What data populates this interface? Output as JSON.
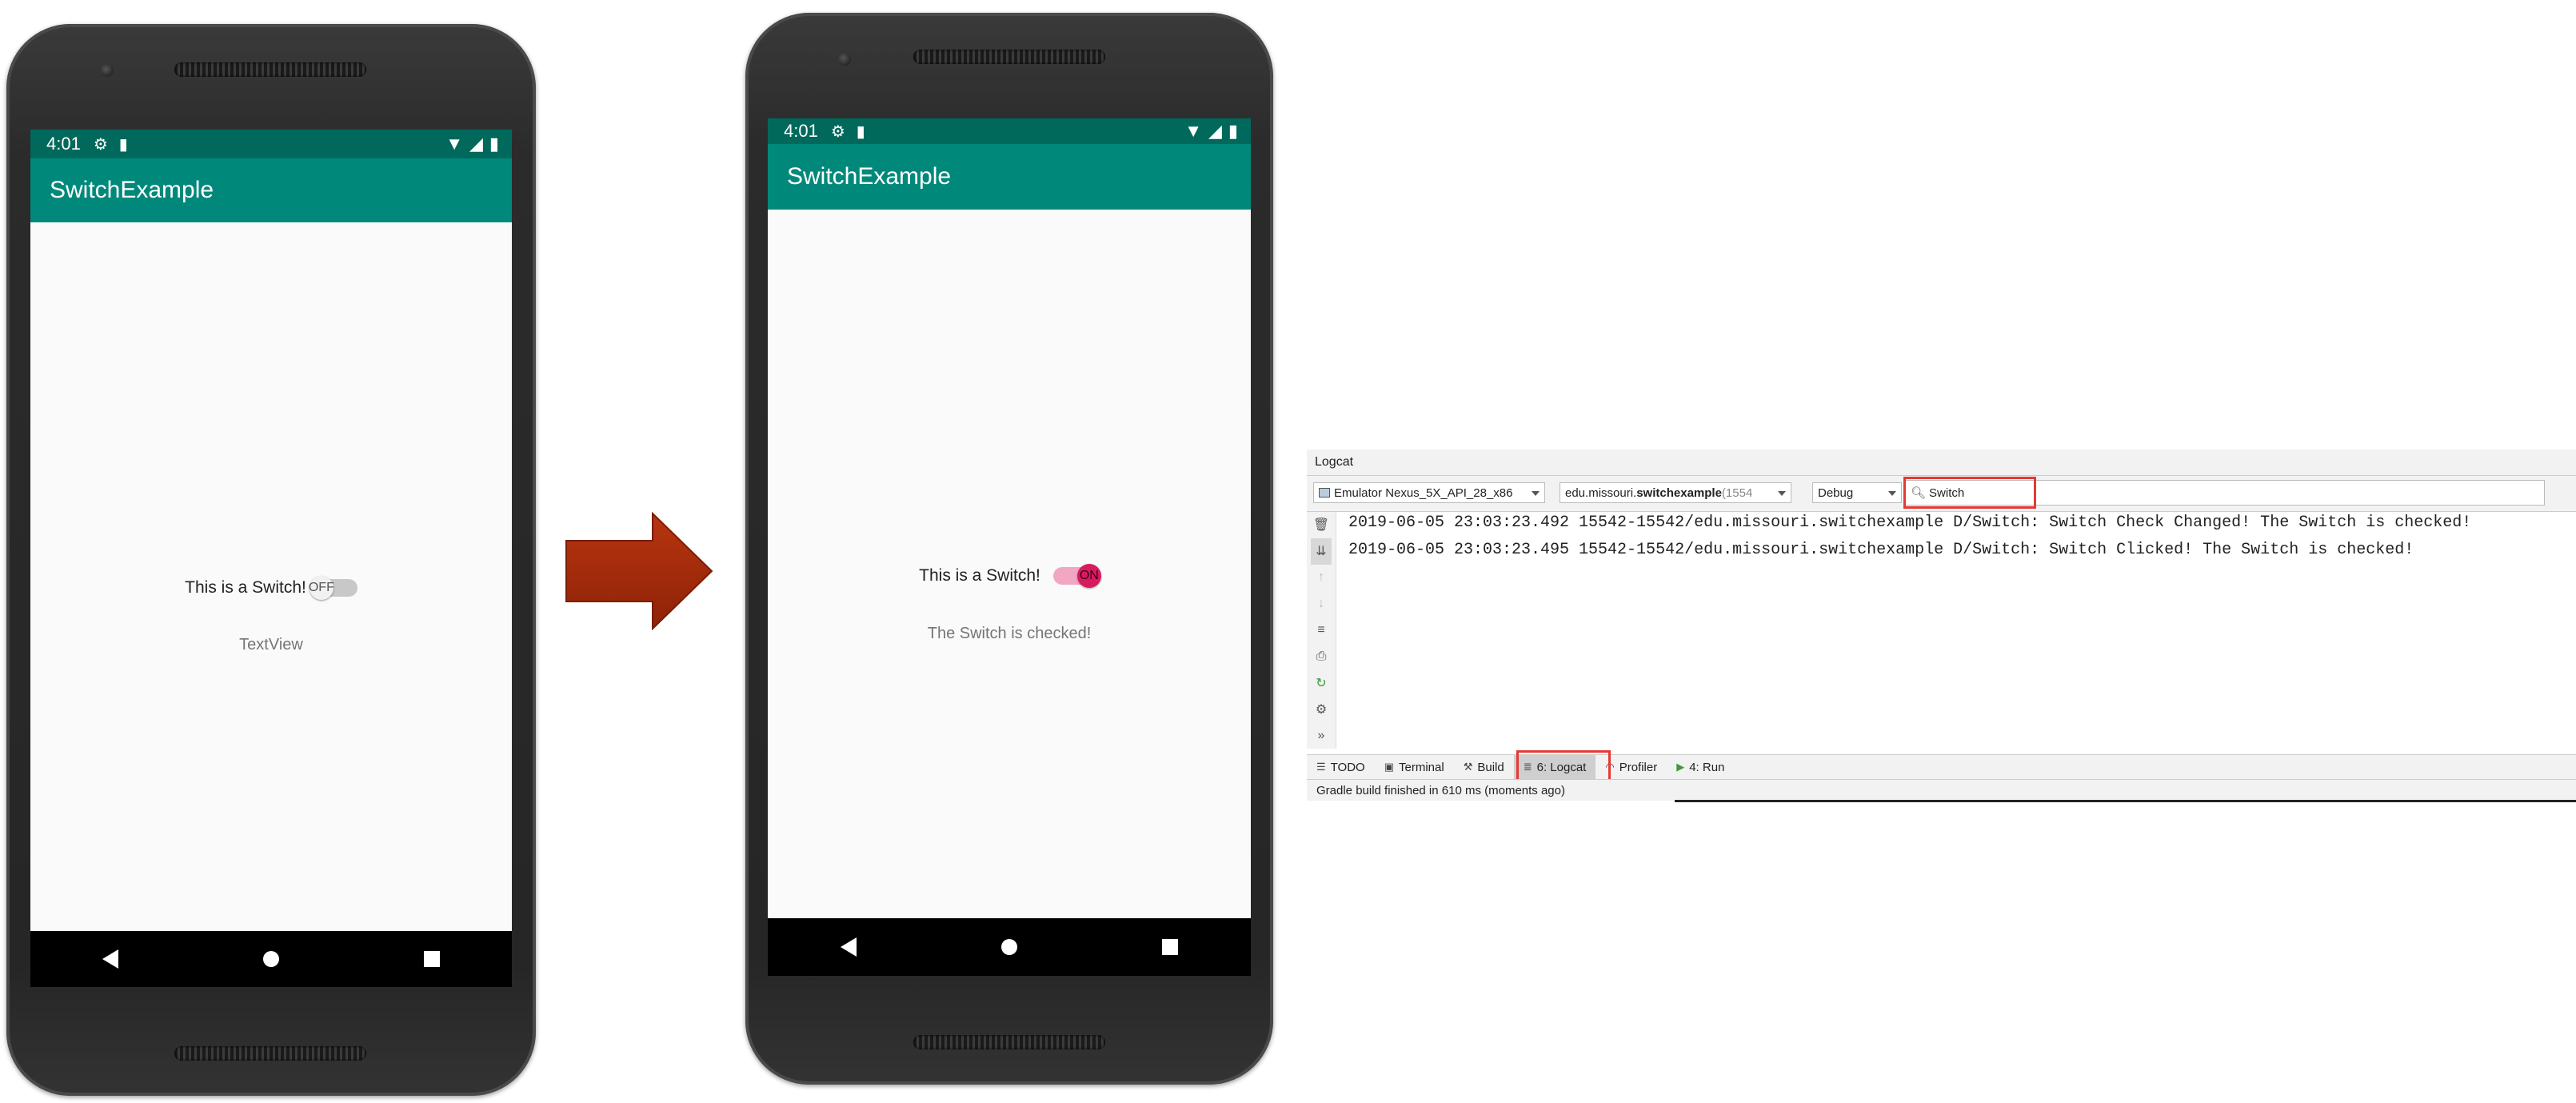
{
  "phone_before": {
    "status_time": "4:01",
    "app_title": "SwitchExample",
    "switch_label": "This is a Switch!",
    "switch_state_text": "OFF",
    "status_text": "TextView"
  },
  "phone_after": {
    "status_time": "4:01",
    "app_title": "SwitchExample",
    "switch_label": "This is a Switch!",
    "switch_state_text": "ON",
    "status_text": "The Switch is checked!"
  },
  "colors": {
    "status_bar": "#00695c",
    "app_bar": "#00897b",
    "switch_on": "#d81b60",
    "arrow": "#a52a0d",
    "highlight": "#e53935"
  },
  "logcat": {
    "panel_title": "Logcat",
    "device": "Emulator Nexus_5X_API_28_x86",
    "process_prefix": "edu.missouri.",
    "process_bold": "switchexample",
    "process_suffix": " (1554",
    "log_level": "Debug",
    "search_value": "Switch",
    "log_lines": [
      "2019-06-05 23:03:23.492 15542-15542/edu.missouri.switchexample D/Switch: Switch Check Changed! The Switch is checked!",
      "2019-06-05 23:03:23.495 15542-15542/edu.missouri.switchexample D/Switch: Switch Clicked! The Switch is checked!"
    ],
    "tool_tabs": {
      "todo": "TODO",
      "terminal": "Terminal",
      "build": "Build",
      "logcat": "6: Logcat",
      "profiler": "Profiler",
      "run": "4: Run"
    },
    "status": "Gradle build finished in 610 ms (moments ago)"
  }
}
